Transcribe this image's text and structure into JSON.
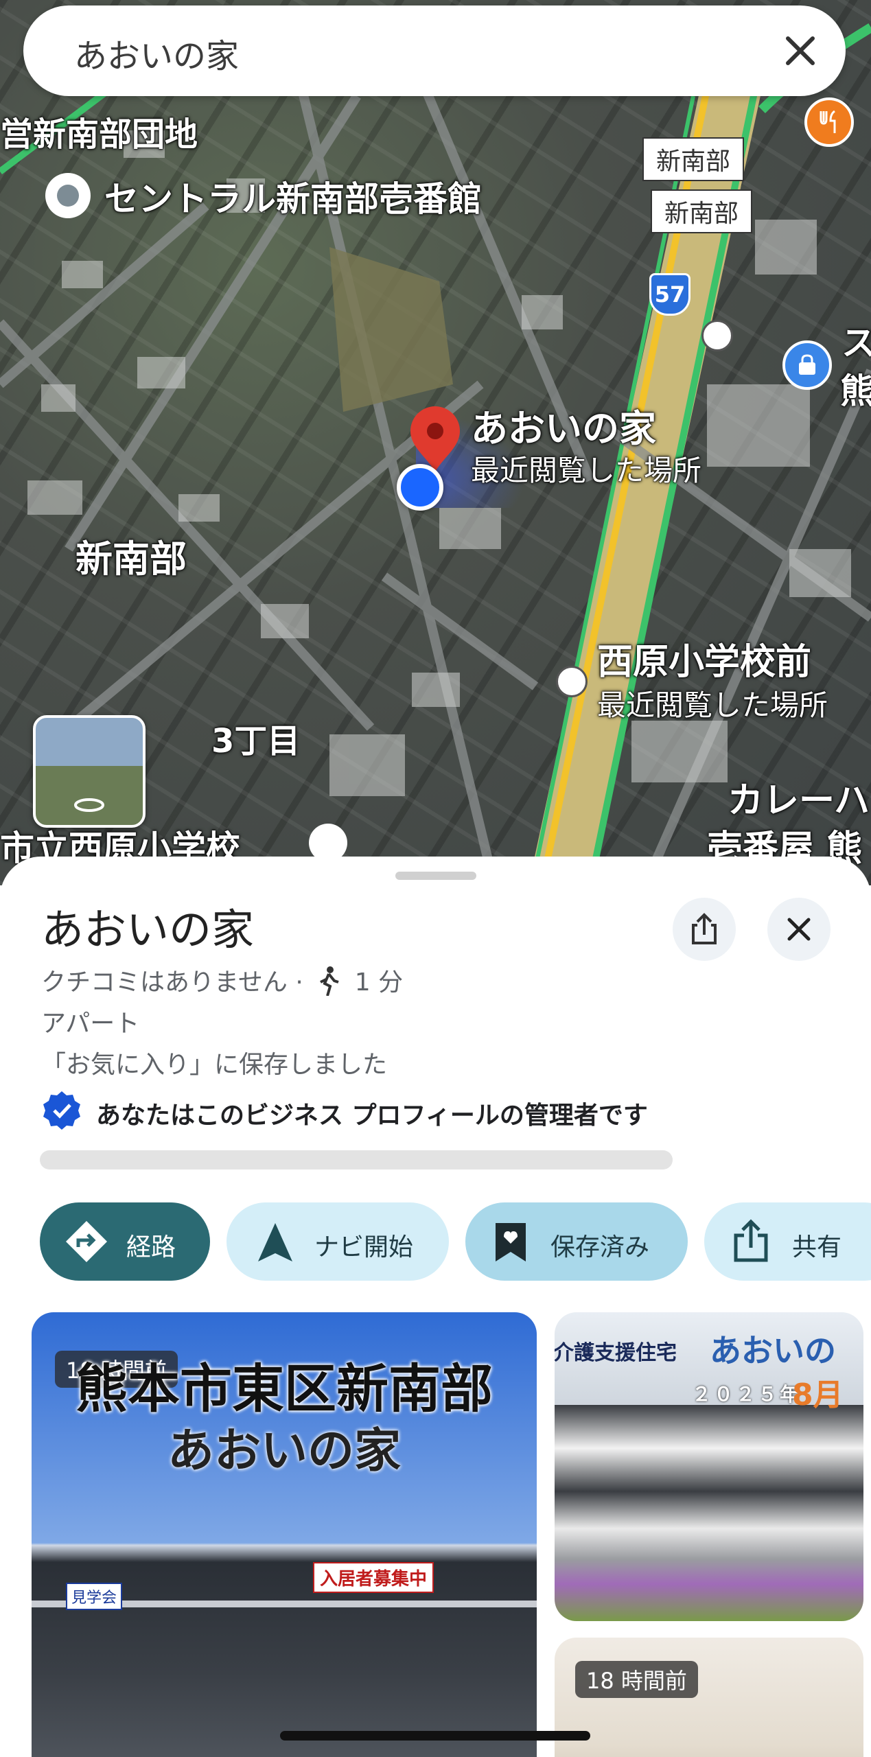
{
  "search": {
    "query": "あおいの家"
  },
  "map": {
    "labels": {
      "danchi": "営新南部団地",
      "central": "セントラル新南部壱番館",
      "station1": "新南部",
      "station2": "新南部",
      "route": "57",
      "shinnanbu": "新南部",
      "chome": "3丁目",
      "school": "市立西原小学校",
      "place_name": "あおいの家",
      "place_sub": "最近閲覧した場所",
      "bus_stop": "西原小学校前",
      "bus_stop_sub": "最近閲覧した場所",
      "curry1": "カレーハ",
      "curry2": "壱番屋 熊",
      "right1": "ス",
      "right2": "熊"
    }
  },
  "place": {
    "title": "あおいの家",
    "reviews": "クチコミはありません ·",
    "walk_time": "1 分",
    "category": "アパート",
    "saved_note": "「お気に入り」に保存しました",
    "owner_note": "あなたはこのビジネス プロフィールの管理者です"
  },
  "actions": {
    "directions": "経路",
    "navigate": "ナビ開始",
    "saved": "保存済み",
    "share": "共有"
  },
  "photos": {
    "main_time": "18 時間前",
    "main_line1": "熊本市東区新南部",
    "main_line2": "あおいの家",
    "banner_open": "見学会",
    "banner_recruit": "入居者募集中",
    "side_top_text": "介護支援住宅",
    "side_top_name": "あおいの",
    "side_top_date": "２０２５年",
    "side_top_month": "8月",
    "side_bottom_time": "18 時間前"
  },
  "colors": {
    "primary": "#2b6a73",
    "chip_light": "#d4eef8",
    "chip_saved": "#a9d8ea",
    "pin_red": "#e03a2e",
    "highway": "#d6c78a"
  }
}
